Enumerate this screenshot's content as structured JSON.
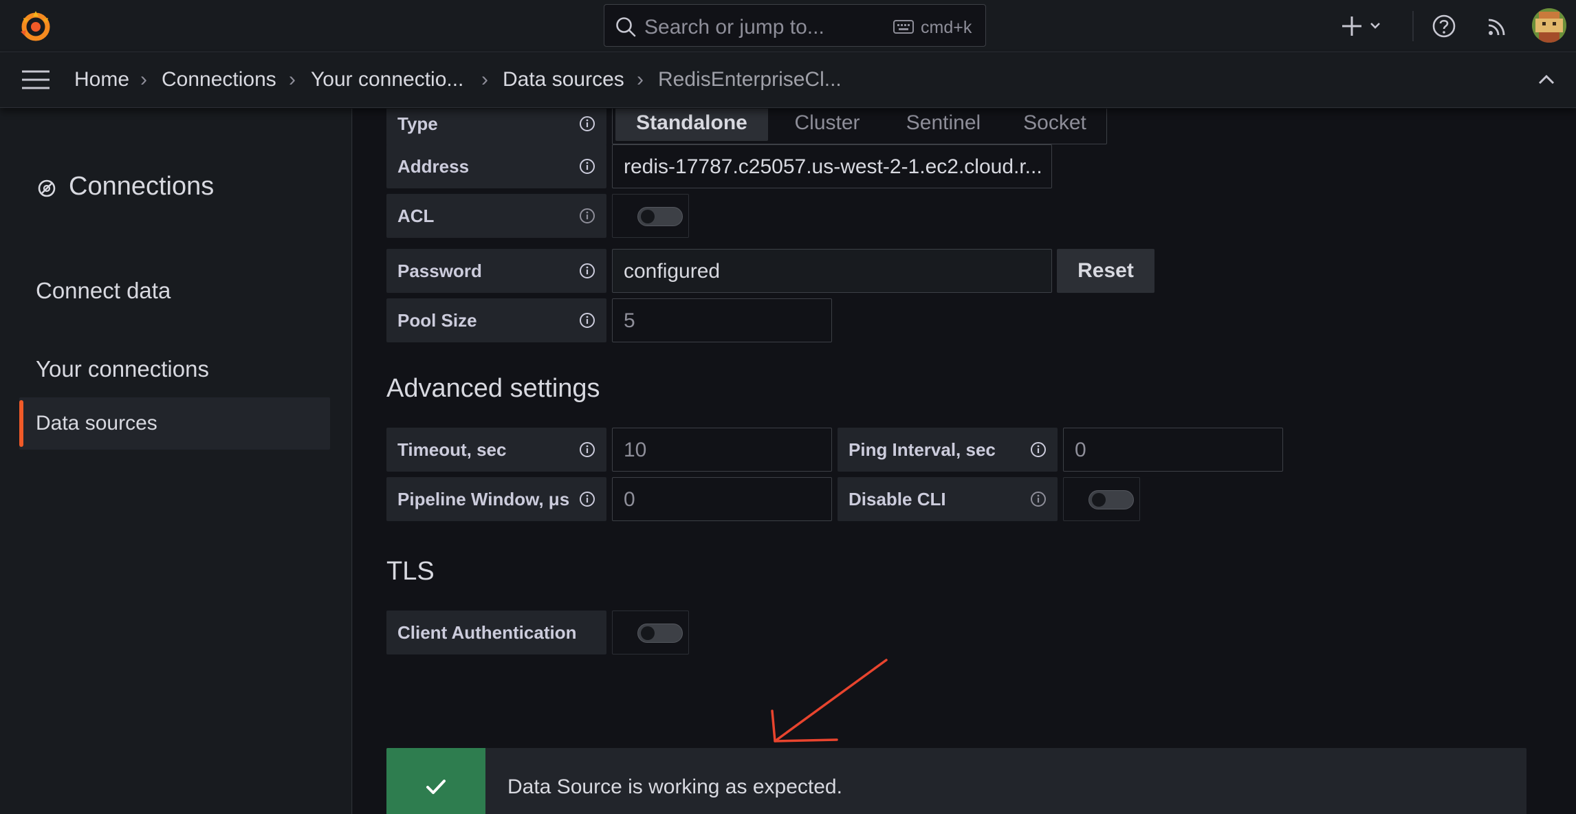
{
  "topbar": {
    "search_placeholder": "Search or jump to...",
    "search_shortcut": "cmd+k"
  },
  "breadcrumb": {
    "items": [
      "Home",
      "Connections",
      "Your connectio...",
      "Data sources",
      "RedisEnterpriseCl..."
    ]
  },
  "sidebar": {
    "title": "Connections",
    "connect_data": "Connect data",
    "your_connections": "Your connections",
    "data_sources": "Data sources"
  },
  "form": {
    "type": {
      "label": "Type",
      "options": [
        "Standalone",
        "Cluster",
        "Sentinel",
        "Socket"
      ],
      "selected": "Standalone"
    },
    "address": {
      "label": "Address",
      "value": "redis-17787.c25057.us-west-2-1.ec2.cloud.r..."
    },
    "acl": {
      "label": "ACL",
      "enabled": false
    },
    "password": {
      "label": "Password",
      "value": "configured",
      "reset_label": "Reset"
    },
    "pool_size": {
      "label": "Pool Size",
      "placeholder": "5"
    }
  },
  "advanced": {
    "heading": "Advanced settings",
    "timeout": {
      "label": "Timeout, sec",
      "placeholder": "10"
    },
    "ping_interval": {
      "label": "Ping Interval, sec",
      "placeholder": "0"
    },
    "pipeline_window": {
      "label": "Pipeline Window, μs",
      "placeholder": "0"
    },
    "disable_cli": {
      "label": "Disable CLI",
      "enabled": false
    }
  },
  "tls": {
    "heading": "TLS",
    "client_auth": {
      "label": "Client Authentication",
      "enabled": false
    }
  },
  "alert": {
    "message": "Data Source is working as expected.",
    "status": "success"
  },
  "colors": {
    "accent": "#f05a28",
    "success": "#2e7d4f",
    "annotation": "#e8442e"
  }
}
